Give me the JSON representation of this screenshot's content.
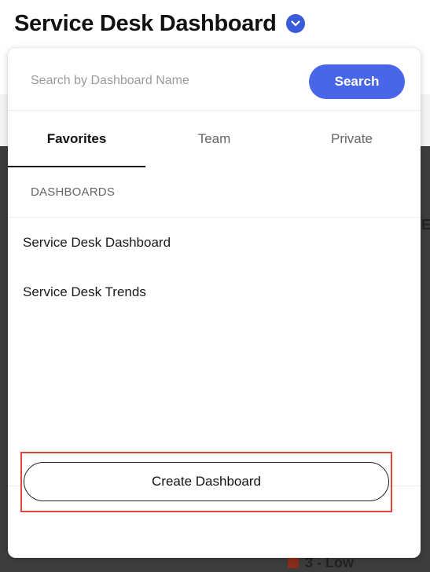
{
  "header": {
    "title": "Service Desk Dashboard",
    "toggle_icon": "chevron-down-icon",
    "accent_color": "#3b5bdb"
  },
  "search": {
    "placeholder": "Search by Dashboard Name",
    "value": "",
    "button_label": "Search",
    "button_color": "#4a66e8"
  },
  "tabs": [
    {
      "label": "Favorites",
      "active": true
    },
    {
      "label": "Team",
      "active": false
    },
    {
      "label": "Private",
      "active": false
    }
  ],
  "section": {
    "header": "DASHBOARDS"
  },
  "dashboards": [
    {
      "label": "Service Desk Dashboard"
    },
    {
      "label": "Service Desk Trends"
    }
  ],
  "footer": {
    "create_label": "Create Dashboard",
    "highlight_color": "#e2453c"
  },
  "background": {
    "legend_label": "3 - Low",
    "edge_letter": "E"
  }
}
